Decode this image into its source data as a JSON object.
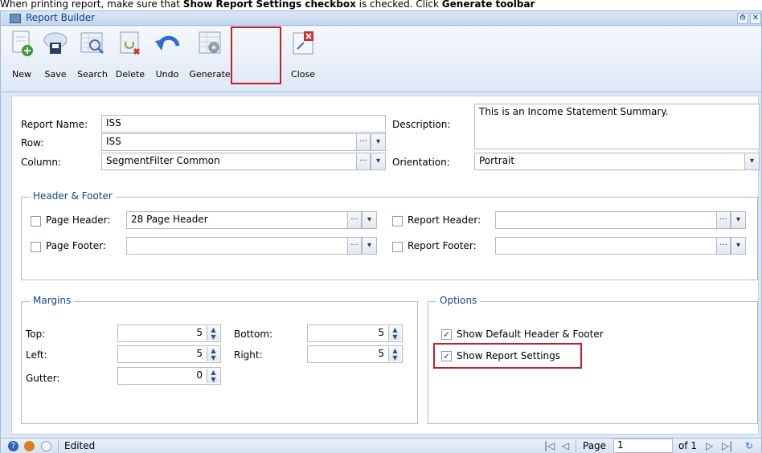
{
  "caption": {
    "prefix": "When printing report, make sure that ",
    "bold1": "Show Report Settings checkbox",
    "middle": " is checked. Click ",
    "bold2": "Generate toolbar"
  },
  "window": {
    "title": "Report Builder",
    "controls": {
      "restore": "⟰",
      "close": "✕"
    }
  },
  "toolbar": {
    "new": "New",
    "save": "Save",
    "search": "Search",
    "delete": "Delete",
    "undo": "Undo",
    "generate": "Generate",
    "close": "Close"
  },
  "form": {
    "report_name_label": "Report Name:",
    "report_name": "ISS",
    "row_label": "Row:",
    "row": "ISS",
    "column_label": "Column:",
    "column": "SegmentFilter Common",
    "description_label": "Description:",
    "description": "This is an Income Statement Summary.",
    "orientation_label": "Orientation:",
    "orientation": "Portrait",
    "ellipsis": "···",
    "dropdown": "▾"
  },
  "header_footer": {
    "legend": "Header & Footer",
    "page_header_label": "Page Header:",
    "page_header": "28 Page Header",
    "page_footer_label": "Page Footer:",
    "page_footer": "",
    "report_header_label": "Report Header:",
    "report_header": "",
    "report_footer_label": "Report Footer:",
    "report_footer": ""
  },
  "margins": {
    "legend": "Margins",
    "top_label": "Top:",
    "top": "5",
    "bottom_label": "Bottom:",
    "bottom": "5",
    "left_label": "Left:",
    "left": "5",
    "right_label": "Right:",
    "right": "5",
    "gutter_label": "Gutter:",
    "gutter": "0"
  },
  "options": {
    "legend": "Options",
    "show_default_header_footer": "Show Default Header & Footer",
    "show_report_settings": "Show Report Settings",
    "check": "✓"
  },
  "status": {
    "text": "Edited",
    "page_label": "Page",
    "page": "1",
    "of": "of 1"
  }
}
